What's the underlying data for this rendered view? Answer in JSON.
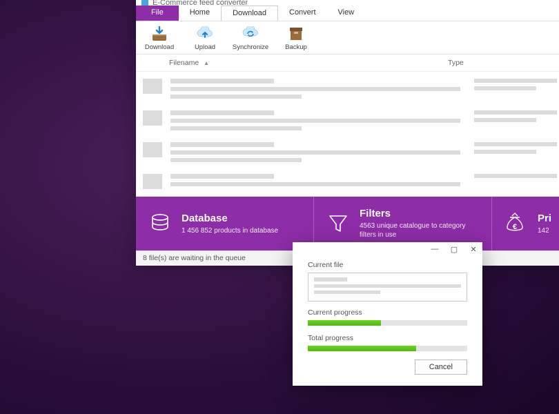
{
  "window": {
    "title": "E-Commerce feed converter"
  },
  "menu": {
    "file": "File",
    "home": "Home",
    "download": "Download",
    "convert": "Convert",
    "view": "View"
  },
  "ribbon": {
    "download": "Download",
    "upload": "Upload",
    "synchronize": "Synchronize",
    "backup": "Backup"
  },
  "columns": {
    "filename": "Filename",
    "type": "Type"
  },
  "stats": {
    "database": {
      "title": "Database",
      "subtitle": "1 456 852 products in database"
    },
    "filters": {
      "title": "Filters",
      "subtitle": "4563 unique catalogue to category filters in use"
    },
    "prices": {
      "title": "Pri",
      "subtitle": "142"
    }
  },
  "status": {
    "queue": "8 file(s) are waiting in the queue"
  },
  "dialog": {
    "current_file_label": "Current file",
    "current_progress_label": "Current progress",
    "total_progress_label": "Total progress",
    "cancel": "Cancel",
    "current_pct": 46,
    "total_pct": 68
  }
}
